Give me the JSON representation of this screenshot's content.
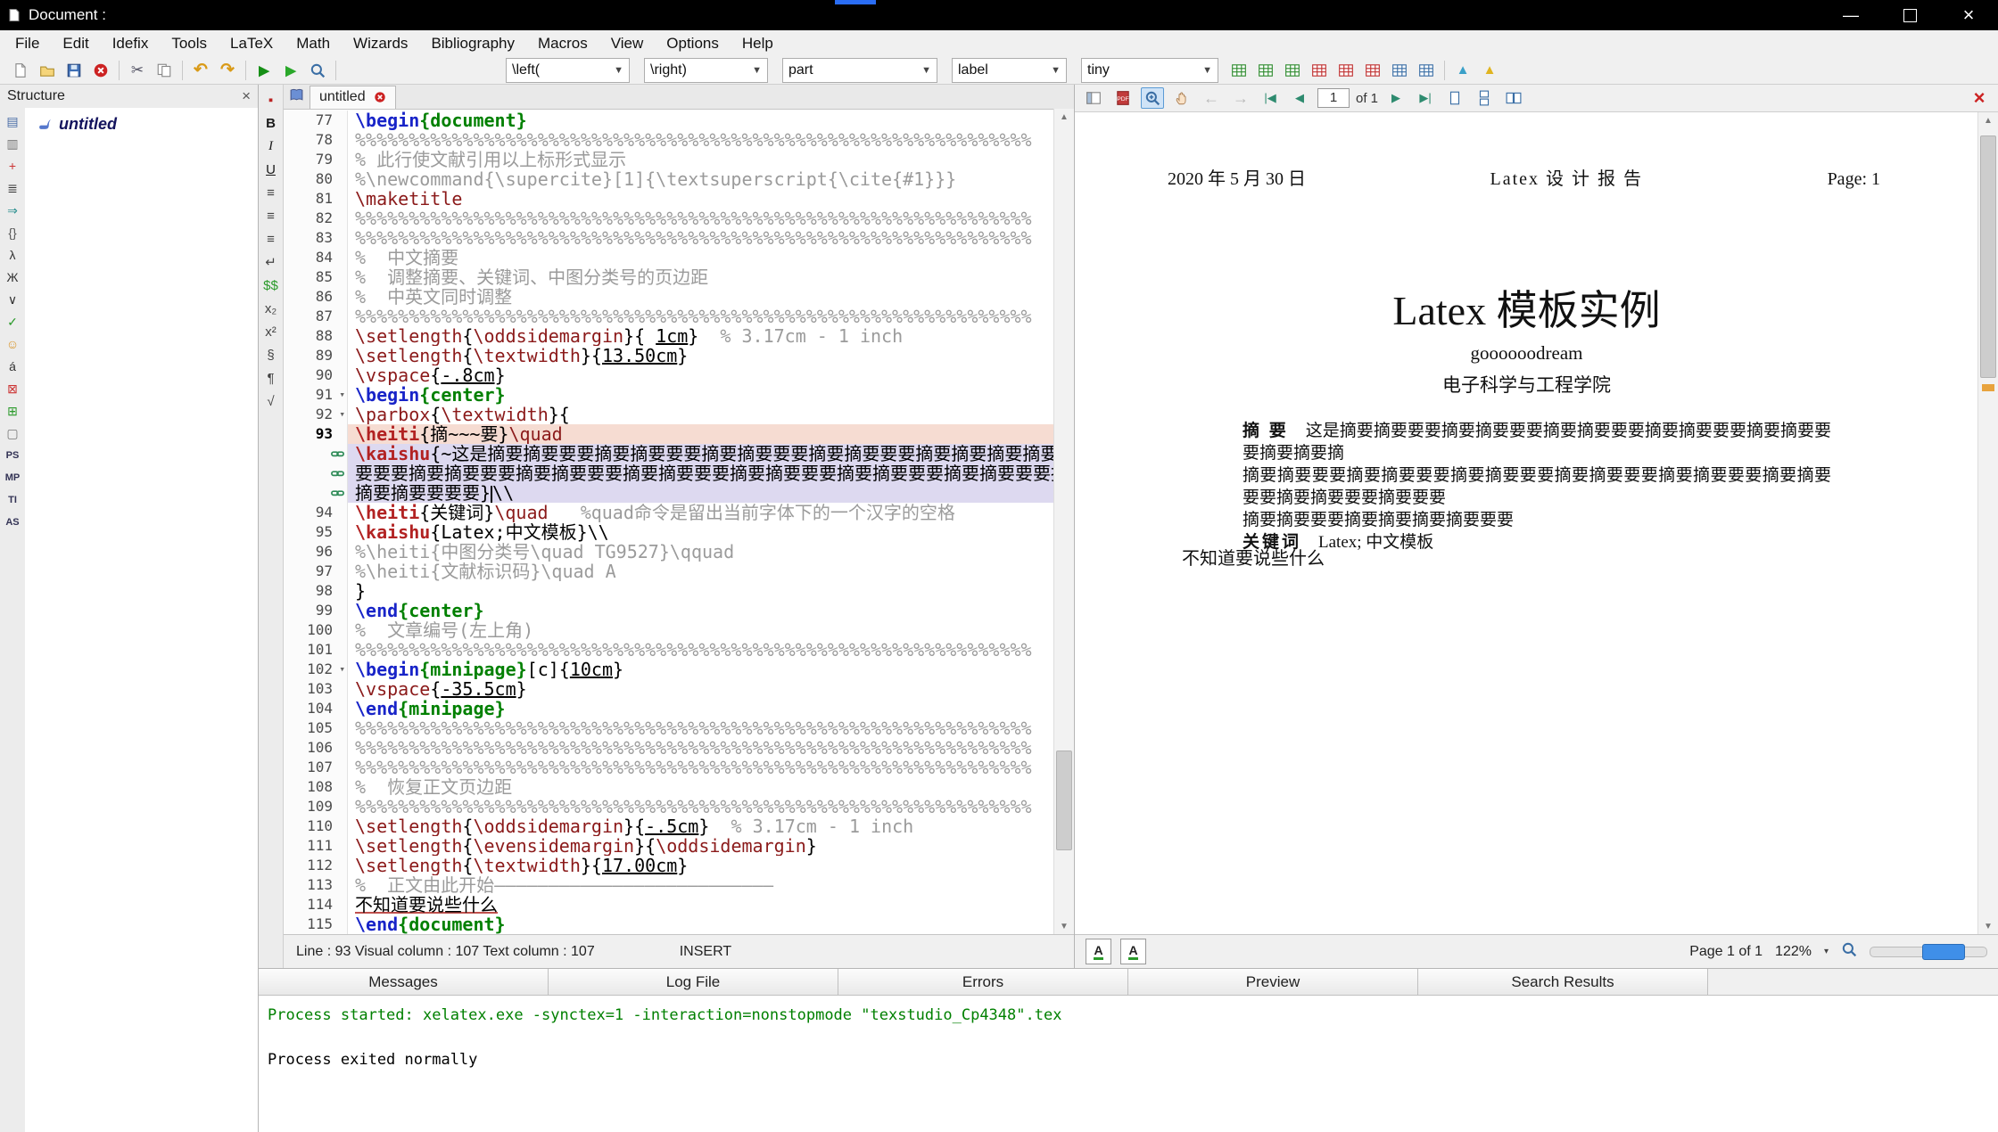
{
  "window": {
    "title": "Document :",
    "buttons": {
      "minimize": "—",
      "close": "×"
    }
  },
  "colors": {
    "accent_blue": "#2a6df4",
    "message_green": "#008000",
    "close_red": "#cc2222",
    "current_line_bg": "#f6dcd2",
    "wrap_line_bg": "#ddd9f0"
  },
  "menu": {
    "items": [
      "File",
      "Edit",
      "Idefix",
      "Tools",
      "LaTeX",
      "Math",
      "Wizards",
      "Bibliography",
      "Macros",
      "View",
      "Options",
      "Help"
    ]
  },
  "toolbar": {
    "icons": [
      "new-file-icon",
      "open-file-icon",
      "save-file-icon",
      "close-document-icon",
      "cut-icon",
      "copy-icon",
      "undo-icon",
      "redo-icon",
      "build-view-icon",
      "compile-icon",
      "view-pdf-icon"
    ],
    "combos": [
      {
        "name": "left-delimiter-combo",
        "value": "\\left("
      },
      {
        "name": "right-delimiter-combo",
        "value": "\\right)"
      },
      {
        "name": "sectioning-combo",
        "value": "part"
      },
      {
        "name": "reference-combo",
        "value": "label"
      },
      {
        "name": "font-size-combo",
        "value": "tiny"
      }
    ],
    "table_icons": [
      "table-add-icon",
      "table-add-row-icon",
      "table-add-column-icon",
      "table-remove-row-icon",
      "table-remove-column-icon",
      "table-remove-icon",
      "table-merge-icon",
      "table-align-icon"
    ],
    "misc_icons": [
      "analysis-triangle-icon",
      "clean-triangle-icon"
    ]
  },
  "side_tabs": [
    {
      "name": "structure-panel-icon",
      "glyph": "▤",
      "color": "#4a6da7"
    },
    {
      "name": "bookmarks-panel-icon",
      "glyph": "▥",
      "color": "#777777"
    },
    {
      "name": "favorites-panel-icon",
      "glyph": "+",
      "color": "#cc3333"
    },
    {
      "name": "relation-symbols-icon",
      "glyph": "≣",
      "color": "#333333"
    },
    {
      "name": "arrow-symbols-icon",
      "glyph": "⇒",
      "color": "#2a8f8f"
    },
    {
      "name": "bracket-symbols-icon",
      "glyph": "{}",
      "color": "#555555"
    },
    {
      "name": "greek-symbols-icon",
      "glyph": "λ",
      "color": "#333333"
    },
    {
      "name": "cyrillic-symbols-icon",
      "glyph": "Ж",
      "color": "#333333"
    },
    {
      "name": "operator-symbols-icon",
      "glyph": "∨",
      "color": "#333333"
    },
    {
      "name": "check-symbols-icon",
      "glyph": "✓",
      "color": "#2a9a2a"
    },
    {
      "name": "smiley-symbols-icon",
      "glyph": "☺",
      "color": "#d9952a"
    },
    {
      "name": "accent-symbols-icon",
      "glyph": "á",
      "color": "#333333"
    },
    {
      "name": "misc-math-symbols-icon",
      "glyph": "⊠",
      "color": "#cc3333"
    },
    {
      "name": "misc-text-symbols-icon",
      "glyph": "⊞",
      "color": "#2a9a2a"
    },
    {
      "name": "frame-symbols-icon",
      "glyph": "▢",
      "color": "#777777"
    },
    {
      "name": "pstricks-panel-icon",
      "glyph": "PS",
      "color": "#333355"
    },
    {
      "name": "metapost-panel-icon",
      "glyph": "MP",
      "color": "#333355"
    },
    {
      "name": "tikz-panel-icon",
      "glyph": "TI",
      "color": "#333355"
    },
    {
      "name": "asymptote-panel-icon",
      "glyph": "AS",
      "color": "#333355"
    }
  ],
  "edit_tools": [
    {
      "name": "bullet-icon",
      "glyph": "▪",
      "color": "#bb2222"
    },
    {
      "name": "bold-icon",
      "glyph": "B",
      "color": "#1a1a1a",
      "s": "b"
    },
    {
      "name": "italic-icon",
      "glyph": "I",
      "color": "#1a1a1a",
      "s": "i"
    },
    {
      "name": "underline-icon",
      "glyph": "U",
      "color": "#1a1a1a",
      "s": "u"
    },
    {
      "name": "align-left-icon",
      "glyph": "≡",
      "color": "#444444"
    },
    {
      "name": "align-center-icon",
      "glyph": "≡",
      "color": "#444444"
    },
    {
      "name": "align-right-icon",
      "glyph": "≡",
      "color": "#444444"
    },
    {
      "name": "linebreak-icon",
      "glyph": "↵",
      "color": "#444444"
    },
    {
      "name": "display-math-icon",
      "glyph": "$$",
      "color": "#2a9a2a"
    },
    {
      "name": "subscript-icon",
      "glyph": "x₂",
      "color": "#444444"
    },
    {
      "name": "superscript-icon",
      "glyph": "x²",
      "color": "#444444"
    },
    {
      "name": "section-symbol-icon",
      "glyph": "§",
      "color": "#444444"
    },
    {
      "name": "paragraph-symbol-icon",
      "glyph": "¶",
      "color": "#444444"
    },
    {
      "name": "sqrt-icon",
      "glyph": "√",
      "color": "#444444"
    }
  ],
  "structure": {
    "title": "Structure",
    "item_label": "untitled"
  },
  "editor": {
    "tab_label": "untitled",
    "status_text": "Line : 93 Visual column : 107 Text column : 107",
    "mode": "INSERT",
    "lines": [
      {
        "n": 77,
        "segs": [
          [
            "kw",
            "\\begin"
          ],
          [
            "env",
            "{document}"
          ]
        ]
      },
      {
        "n": 78,
        "segs": [
          [
            "rep",
            63
          ]
        ]
      },
      {
        "n": 79,
        "segs": [
          [
            "c",
            "% 此行使文献引用以上标形式显示"
          ]
        ]
      },
      {
        "n": 80,
        "segs": [
          [
            "c",
            "%\\newcommand{\\supercite}[1]{\\textsuperscript{\\cite{#1}}}"
          ]
        ]
      },
      {
        "n": 81,
        "segs": [
          [
            "cmd",
            "\\maketitle"
          ]
        ]
      },
      {
        "n": 82,
        "segs": [
          [
            "rep",
            63
          ]
        ]
      },
      {
        "n": 83,
        "segs": [
          [
            "rep",
            63
          ]
        ]
      },
      {
        "n": 84,
        "segs": [
          [
            "c",
            "%  中文摘要"
          ]
        ]
      },
      {
        "n": 85,
        "segs": [
          [
            "c",
            "%  调整摘要、关键词、中图分类号的页边距"
          ]
        ]
      },
      {
        "n": 86,
        "segs": [
          [
            "c",
            "%  中英文同时调整"
          ]
        ]
      },
      {
        "n": 87,
        "segs": [
          [
            "rep",
            63
          ]
        ]
      },
      {
        "n": 88,
        "segs": [
          [
            "cmd",
            "\\setlength"
          ],
          [
            "t",
            "{"
          ],
          [
            "cmd",
            "\\oddsidemargin"
          ],
          [
            "t",
            "}{ "
          ],
          [
            "u",
            "1cm"
          ],
          [
            "t",
            "}"
          ],
          [
            "c",
            "  % 3.17cm - 1 inch"
          ]
        ]
      },
      {
        "n": 89,
        "segs": [
          [
            "cmd",
            "\\setlength"
          ],
          [
            "t",
            "{"
          ],
          [
            "cmd",
            "\\textwidth"
          ],
          [
            "t",
            "}{"
          ],
          [
            "u",
            "13.50cm"
          ],
          [
            "t",
            "}"
          ]
        ]
      },
      {
        "n": 90,
        "segs": [
          [
            "cmd",
            "\\vspace"
          ],
          [
            "t",
            "{"
          ],
          [
            "u",
            "-.8cm"
          ],
          [
            "t",
            "}"
          ]
        ]
      },
      {
        "n": 91,
        "fold": true,
        "segs": [
          [
            "kw",
            "\\begin"
          ],
          [
            "env",
            "{center}"
          ]
        ]
      },
      {
        "n": 92,
        "fold": true,
        "segs": [
          [
            "cmd",
            "\\parbox"
          ],
          [
            "t",
            "{"
          ],
          [
            "cmd",
            "\\textwidth"
          ],
          [
            "t",
            "}{"
          ]
        ]
      },
      {
        "n": 93,
        "current": true,
        "rows": [
          {
            "hl": "cur",
            "segs": [
              [
                "cmdb",
                "\\heiti"
              ],
              [
                "t",
                "{摘~~~要}"
              ],
              [
                "cmd",
                "\\quad"
              ]
            ]
          },
          {
            "hl": "wrap",
            "link": true,
            "segs": [
              [
                "cmdb",
                "\\kaishu"
              ],
              [
                "t",
                "{~这是摘要摘要要要摘要摘要要要摘要摘要要要摘要摘要要要摘要摘要摘要摘要要要摘要摘要摘"
              ]
            ]
          },
          {
            "hl": "wrap",
            "link": true,
            "segs": [
              [
                "t",
                "要要要摘要摘要要要摘要摘要要要摘要摘要要要摘要摘要要要摘要摘要要要摘要摘要要要摘要摘要要要摘要摘要要"
              ]
            ]
          },
          {
            "hl": "wrap",
            "link": true,
            "segs": [
              [
                "t",
                "摘要摘要要要要}"
              ],
              [
                "cursor",
                0
              ],
              [
                "t",
                "\\\\"
              ]
            ]
          }
        ]
      },
      {
        "n": 94,
        "segs": [
          [
            "cmdb",
            "\\heiti"
          ],
          [
            "t",
            "{关键词}"
          ],
          [
            "cmd",
            "\\quad"
          ],
          [
            "t",
            "   "
          ],
          [
            "c",
            "%quad命令是留出当前字体下的一个汉字的空格"
          ]
        ]
      },
      {
        "n": 95,
        "segs": [
          [
            "cmdb",
            "\\kaishu"
          ],
          [
            "t",
            "{Latex;中文模板}\\\\"
          ]
        ]
      },
      {
        "n": 96,
        "segs": [
          [
            "c",
            "%\\heiti{中图分类号\\quad TG9527}\\qquad"
          ]
        ]
      },
      {
        "n": 97,
        "segs": [
          [
            "c",
            "%\\heiti{文献标识码}\\quad A"
          ]
        ]
      },
      {
        "n": 98,
        "segs": [
          [
            "t",
            "}"
          ]
        ]
      },
      {
        "n": 99,
        "segs": [
          [
            "kw",
            "\\end"
          ],
          [
            "env",
            "{center}"
          ]
        ]
      },
      {
        "n": 100,
        "segs": [
          [
            "c",
            "%  文章编号(左上角)"
          ]
        ]
      },
      {
        "n": 101,
        "segs": [
          [
            "rep",
            63
          ]
        ]
      },
      {
        "n": 102,
        "fold": true,
        "segs": [
          [
            "kw",
            "\\begin"
          ],
          [
            "env",
            "{minipage}"
          ],
          [
            "t",
            "[c]{"
          ],
          [
            "u",
            "10cm"
          ],
          [
            "t",
            "}"
          ]
        ]
      },
      {
        "n": 103,
        "segs": [
          [
            "cmd",
            "\\vspace"
          ],
          [
            "t",
            "{"
          ],
          [
            "u",
            "-35.5cm"
          ],
          [
            "t",
            "}"
          ]
        ]
      },
      {
        "n": 104,
        "segs": [
          [
            "kw",
            "\\end"
          ],
          [
            "env",
            "{minipage}"
          ]
        ]
      },
      {
        "n": 105,
        "segs": [
          [
            "rep",
            63
          ]
        ]
      },
      {
        "n": 106,
        "segs": [
          [
            "rep",
            63
          ]
        ]
      },
      {
        "n": 107,
        "segs": [
          [
            "rep",
            63
          ]
        ]
      },
      {
        "n": 108,
        "segs": [
          [
            "c",
            "%  恢复正文页边距"
          ]
        ]
      },
      {
        "n": 109,
        "segs": [
          [
            "rep",
            63
          ]
        ]
      },
      {
        "n": 110,
        "segs": [
          [
            "cmd",
            "\\setlength"
          ],
          [
            "t",
            "{"
          ],
          [
            "cmd",
            "\\oddsidemargin"
          ],
          [
            "t",
            "}{"
          ],
          [
            "u",
            "-.5cm"
          ],
          [
            "t",
            "}"
          ],
          [
            "c",
            "  % 3.17cm - 1 inch"
          ]
        ]
      },
      {
        "n": 111,
        "segs": [
          [
            "cmd",
            "\\setlength"
          ],
          [
            "t",
            "{"
          ],
          [
            "cmd",
            "\\evensidemargin"
          ],
          [
            "t",
            "}{"
          ],
          [
            "cmd",
            "\\oddsidemargin"
          ],
          [
            "t",
            "}"
          ]
        ]
      },
      {
        "n": 112,
        "segs": [
          [
            "cmd",
            "\\setlength"
          ],
          [
            "t",
            "{"
          ],
          [
            "cmd",
            "\\textwidth"
          ],
          [
            "t",
            "}{"
          ],
          [
            "u",
            "17.00cm"
          ],
          [
            "t",
            "}"
          ]
        ]
      },
      {
        "n": 113,
        "segs": [
          [
            "c",
            "%  正文由此开始——————————————————————————"
          ]
        ]
      },
      {
        "n": 114,
        "segs": [
          [
            "sp",
            "不知道要说些什么"
          ]
        ]
      },
      {
        "n": 115,
        "segs": [
          [
            "kw",
            "\\end"
          ],
          [
            "env",
            "{document}"
          ]
        ]
      }
    ]
  },
  "pdf": {
    "toolbar_left": [
      "toggle-sidebar-icon",
      "print-pdf-icon",
      "zoom-in-icon",
      "hand-tool-icon",
      "back-icon",
      "forward-icon",
      "first-page-icon",
      "prev-page-icon"
    ],
    "page_value": "1",
    "page_of": "of 1",
    "toolbar_right": [
      "next-page-icon",
      "last-page-icon",
      "single-page-icon",
      "continuous-page-icon",
      "facing-pages-icon"
    ],
    "close_icon": "close-viewer-icon",
    "doc": {
      "header_date": "2020 年 5 月 30 日",
      "header_center": "Latex 设 计 报 告",
      "header_page": "Page: 1",
      "title": "Latex 模板实例",
      "author": "goooooodream",
      "department": "电子科学与工程学院",
      "abstract_label": "摘 要",
      "abstract_lines": [
        "这是摘要摘要要要摘要摘要要要摘要摘要要要摘要摘要要要摘要摘要要要摘要摘要摘",
        "摘要摘要要要摘要摘要要要摘要摘要要要摘要摘要要要摘要摘要要要摘要摘要要要摘要摘要要要摘要要要",
        "摘要摘要要要摘要摘要摘要摘要要要"
      ],
      "keywords_label": "关键词",
      "keywords": "Latex; 中文模板",
      "body_text": "不知道要说些什么"
    },
    "a_buttons": [
      "a-toggle-icon-1",
      "a-toggle-icon-2"
    ],
    "controls": {
      "page_label": "Page 1 of 1",
      "zoom_label": "122%"
    }
  },
  "bottom_panel": {
    "tabs": [
      "Messages",
      "Log File",
      "Errors",
      "Preview",
      "Search Results"
    ],
    "messages": [
      {
        "text": "Process started: xelatex.exe -synctex=1 -interaction=nonstopmode \"texstudio_Cp4348\".tex",
        "type": "info"
      },
      {
        "text": "Process exited normally",
        "type": "normal"
      }
    ]
  }
}
